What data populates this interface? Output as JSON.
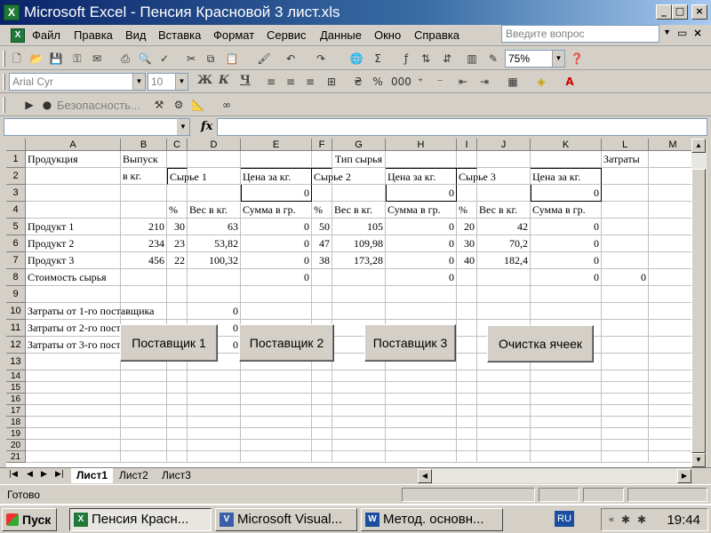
{
  "window": {
    "title": "Microsoft Excel - Пенсия Красновой 3 лист.xls"
  },
  "menu": [
    "Файл",
    "Правка",
    "Вид",
    "Вставка",
    "Формат",
    "Сервис",
    "Данные",
    "Окно",
    "Справка"
  ],
  "help_placeholder": "Введите вопрос",
  "toolbar": {
    "zoom": "75%",
    "font": "Arial Cyr",
    "font_size": "10",
    "security": "Безопасность..."
  },
  "formula": {
    "fx": "fx",
    "name_box": "",
    "content": ""
  },
  "columns": [
    "A",
    "B",
    "C",
    "D",
    "E",
    "F",
    "G",
    "H",
    "I",
    "J",
    "K",
    "L",
    "M"
  ],
  "rows": [
    "1",
    "2",
    "3",
    "4",
    "5",
    "6",
    "7",
    "8",
    "9",
    "10",
    "11",
    "12",
    "13",
    "14",
    "15",
    "16",
    "17",
    "18",
    "19",
    "20",
    "21"
  ],
  "cells": {
    "A1": "Продукция",
    "B1": "Выпуск",
    "G1": "Тип сырья",
    "L1": "Затраты",
    "B2": "в кг.",
    "C2": "Сырье 1",
    "E2": "Цена за кг.",
    "F2": "Сырье 2",
    "H2": "Цена за кг.",
    "I2": "Сырье 3",
    "K2": "Цена за кг.",
    "E3": "0",
    "H3": "0",
    "K3": "0",
    "C4": "%",
    "D4": "Вес в кг.",
    "E4": "Сумма в гр.",
    "F4": "%",
    "G4": "Вес в кг.",
    "H4": "Сумма в гр.",
    "I4": "%",
    "J4": "Вес в кг.",
    "K4": "Сумма в гр.",
    "A5": "Продукт 1",
    "B5": "210",
    "C5": "30",
    "D5": "63",
    "E5": "0",
    "F5": "50",
    "G5": "105",
    "H5": "0",
    "I5": "20",
    "J5": "42",
    "K5": "0",
    "A6": "Продукт 2",
    "B6": "234",
    "C6": "23",
    "D6": "53,82",
    "E6": "0",
    "F6": "47",
    "G6": "109,98",
    "H6": "0",
    "I6": "30",
    "J6": "70,2",
    "K6": "0",
    "A7": "Продукт 3",
    "B7": "456",
    "C7": "22",
    "D7": "100,32",
    "E7": "0",
    "F7": "38",
    "G7": "173,28",
    "H7": "0",
    "I7": "40",
    "J7": "182,4",
    "K7": "0",
    "A8": "Стоимость сырья",
    "E8": "0",
    "H8": "0",
    "K8": "0",
    "L8": "0",
    "A10": "Затраты от 1-го   поставщика",
    "D10": "0",
    "A11": "Затраты от 2-го  поставщика",
    "D11": "0",
    "A12": "Затраты от 3-го   поставщика",
    "D12": "0"
  },
  "buttons": {
    "supplier1": "Поставщик 1",
    "supplier2": "Поставщик 2",
    "supplier3": "Поставщик 3",
    "clear": "Очистка ячеек"
  },
  "sheets": [
    "Лист1",
    "Лист2",
    "Лист3"
  ],
  "status": "Готово",
  "taskbar": {
    "start": "Пуск",
    "items": [
      "Пенсия Красн...",
      "Microsoft Visual...",
      "Метод. основн..."
    ],
    "lang": "RU",
    "clock": "19:44"
  }
}
